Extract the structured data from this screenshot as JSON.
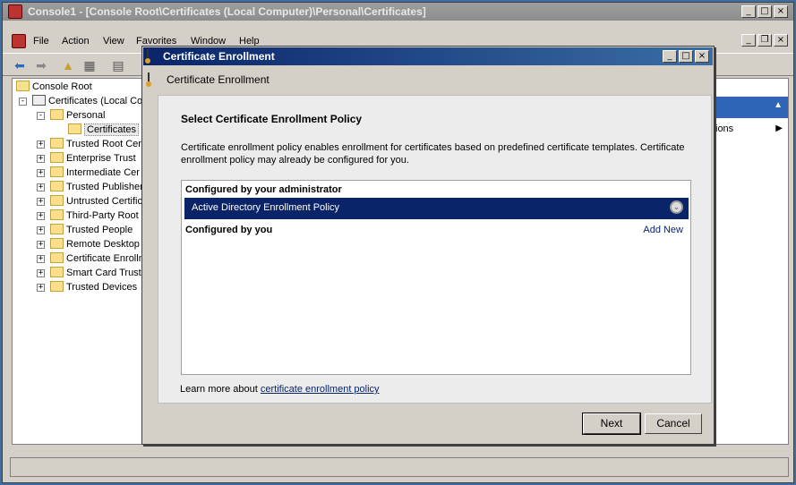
{
  "mmc": {
    "title": "Console1 - [Console Root\\Certificates (Local Computer)\\Personal\\Certificates]",
    "menu": [
      "File",
      "Action",
      "View",
      "Favorites",
      "Window",
      "Help"
    ],
    "tree": {
      "root": "Console Root",
      "certificates": "Certificates (Local Co",
      "personal": "Personal",
      "personal_certs": "Certificates",
      "stores": [
        "Trusted Root Cer",
        "Enterprise Trust",
        "Intermediate Cer",
        "Trusted Publisher",
        "Untrusted Certific",
        "Third-Party Root",
        "Trusted People",
        "Remote Desktop",
        "Certificate Enrolln",
        "Smart Card Truste",
        "Trusted Devices"
      ]
    },
    "actions_more": "ions"
  },
  "dialog": {
    "title": "Certificate Enrollment",
    "header": "Certificate Enrollment",
    "section_title": "Select Certificate Enrollment Policy",
    "description": "Certificate enrollment policy enables enrollment for certificates based on predefined certificate templates. Certificate enrollment policy may already be configured for you.",
    "group_admin": "Configured by your administrator",
    "policy_name": "Active Directory Enrollment Policy",
    "group_you": "Configured by you",
    "add_new": "Add New",
    "learn_prefix": "Learn more about ",
    "learn_link": "certificate enrollment policy",
    "next_label": "Next",
    "cancel_label": "Cancel"
  }
}
